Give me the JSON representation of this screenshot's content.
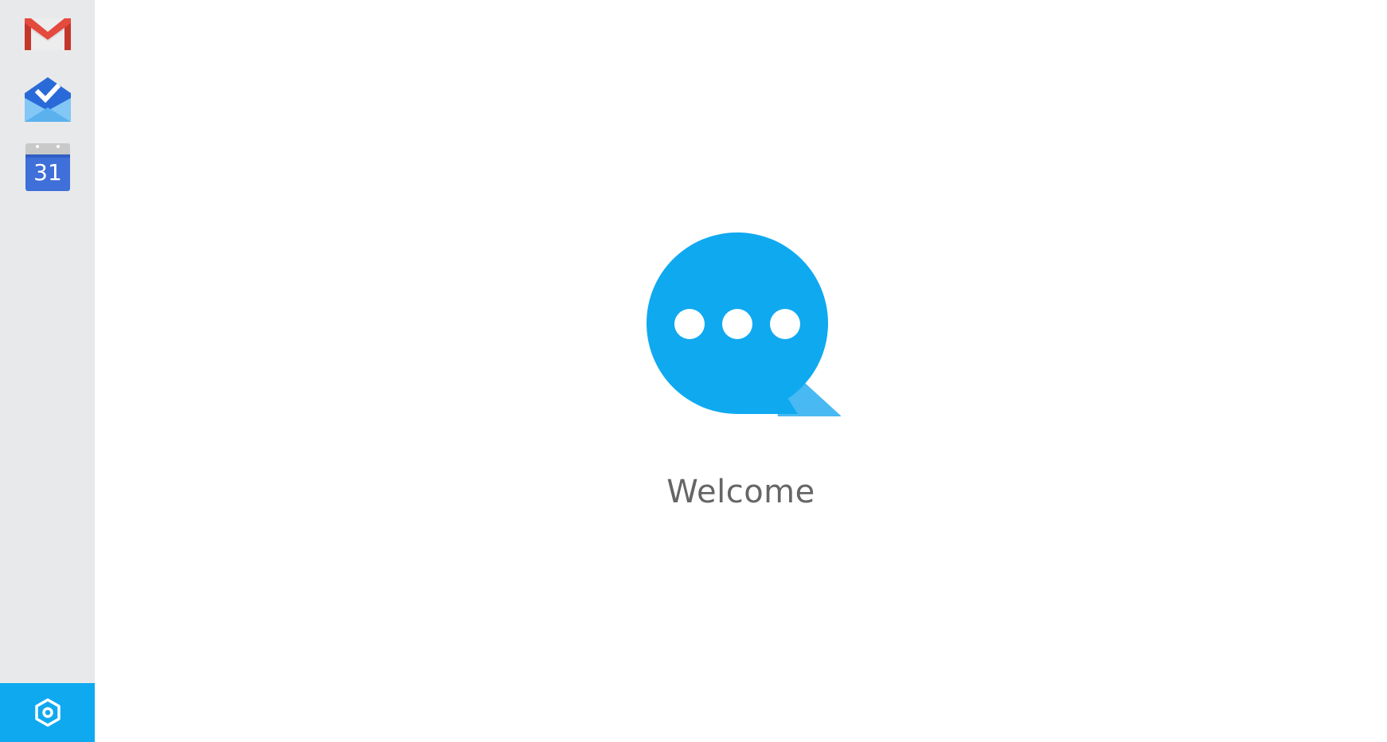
{
  "sidebar": {
    "apps": [
      {
        "name": "gmail",
        "icon": "gmail-icon"
      },
      {
        "name": "inbox",
        "icon": "inbox-icon"
      },
      {
        "name": "calendar",
        "icon": "calendar-icon",
        "day": "31"
      }
    ],
    "settings": {
      "icon": "settings-icon",
      "background": "#0fa9f0"
    }
  },
  "main": {
    "logo_icon": "chat-bubble-icon",
    "welcome_text": "Welcome"
  },
  "colors": {
    "accent": "#0fa9f0",
    "sidebar_bg": "#e8e9ea",
    "text": "#666666"
  }
}
